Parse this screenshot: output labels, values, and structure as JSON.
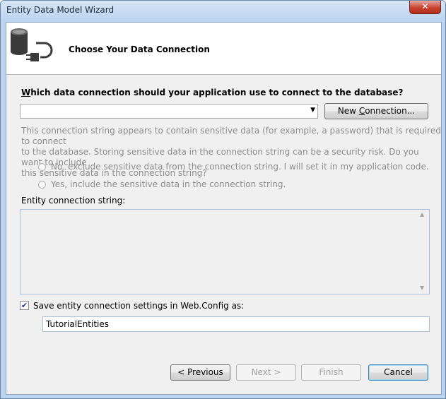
{
  "window": {
    "title": "Entity Data Model Wizard",
    "close_glyph": "✕"
  },
  "header": {
    "title": "Choose Your Data Connection",
    "icon": "database-plug-icon"
  },
  "question": {
    "mnemonic": "W",
    "rest": "hich data connection should your application use to connect to the database?"
  },
  "connection_combo": {
    "value": ""
  },
  "new_connection_button": {
    "pre": "New ",
    "mnemonic": "C",
    "post": "onnection..."
  },
  "sensitive_text": {
    "line1": "This connection string appears to contain sensitive data (for example, a password) that is required to connect",
    "line2": "to the database. Storing sensitive data in the connection string can be a security risk. Do you want to include",
    "line3": "this sensitive data in the connection string?"
  },
  "radio_no": {
    "label": "No, exclude sensitive data from the connection string. I will set it in my application code."
  },
  "radio_yes": {
    "label": "Yes, include the sensitive data in the connection string."
  },
  "entity_connection": {
    "label": "Entity connection string:",
    "value": ""
  },
  "save_settings": {
    "checked": true,
    "label": "Save entity connection settings in Web.Config as:"
  },
  "config_name": {
    "value": "TutorialEntities"
  },
  "buttons": {
    "previous": "< Previous",
    "next": "Next >",
    "finish": "Finish",
    "cancel": "Cancel"
  }
}
